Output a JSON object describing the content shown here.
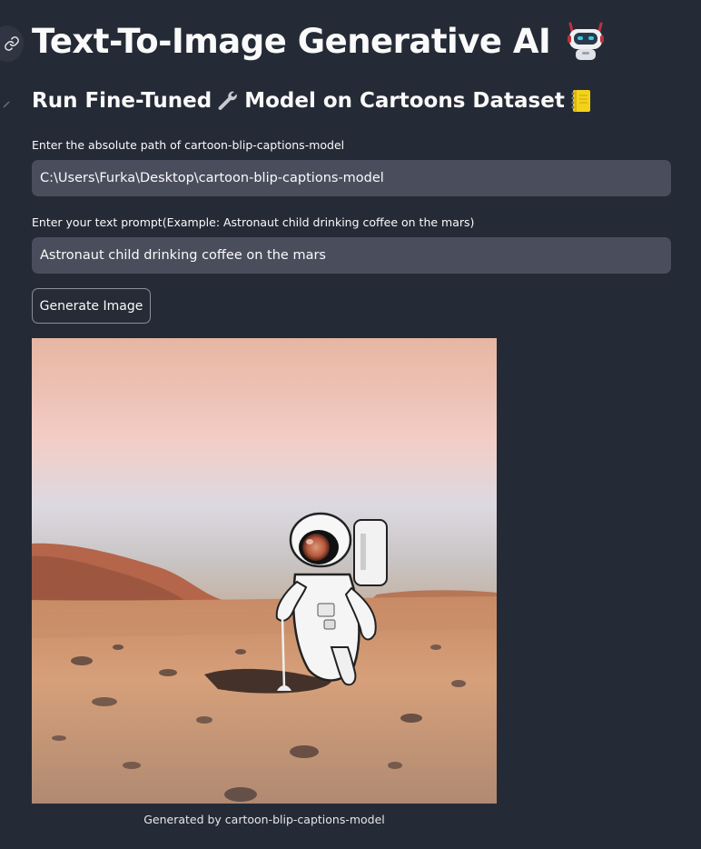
{
  "header": {
    "title": "Text-To-Image Generative AI",
    "subtitle_part1": "Run Fine-Tuned",
    "subtitle_part2": "Model on Cartoons Dataset"
  },
  "icons": {
    "title_icon": "robot-icon",
    "subtitle_icon_1": "wrench-icon",
    "subtitle_icon_2": "notebook-icon",
    "anchor_icon": "link-icon"
  },
  "form": {
    "model_path": {
      "label": "Enter the absolute path of cartoon-blip-captions-model",
      "value": "C:\\Users\\Furka\\Desktop\\cartoon-blip-captions-model"
    },
    "prompt": {
      "label": "Enter your text prompt(Example: Astronaut child drinking coffee on the mars)",
      "value": "Astronaut child drinking coffee on the mars"
    },
    "generate_button": "Generate Image"
  },
  "result": {
    "caption": "Generated by cartoon-blip-captions-model"
  },
  "colors": {
    "background": "#252b36",
    "input_background": "#4a4e5c",
    "text": "#fafafa"
  }
}
